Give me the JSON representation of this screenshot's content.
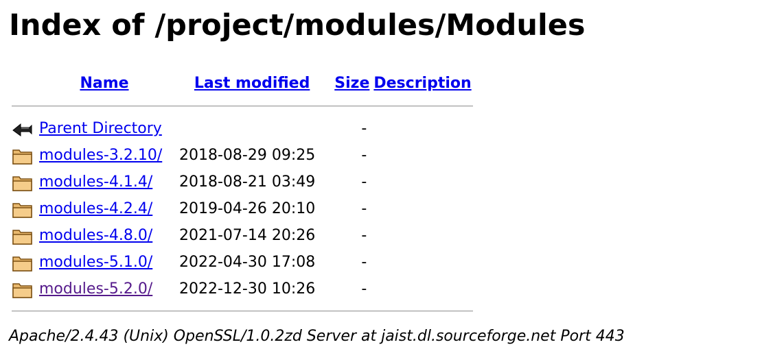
{
  "title": "Index of /project/modules/Modules",
  "columns": {
    "name": "Name",
    "last_modified": "Last modified",
    "size": "Size",
    "description": "Description"
  },
  "parent": {
    "label": "Parent Directory",
    "size": "-",
    "icon": "back-icon"
  },
  "rows": [
    {
      "name": "modules-3.2.10/",
      "date": "2018-08-29 09:25",
      "size": "-",
      "icon": "folder-icon"
    },
    {
      "name": "modules-4.1.4/",
      "date": "2018-08-21 03:49",
      "size": "-",
      "icon": "folder-icon"
    },
    {
      "name": "modules-4.2.4/",
      "date": "2019-04-26 20:10",
      "size": "-",
      "icon": "folder-icon"
    },
    {
      "name": "modules-4.8.0/",
      "date": "2021-07-14 20:26",
      "size": "-",
      "icon": "folder-icon"
    },
    {
      "name": "modules-5.1.0/",
      "date": "2022-04-30 17:08",
      "size": "-",
      "icon": "folder-icon"
    },
    {
      "name": "modules-5.2.0/",
      "date": "2022-12-30 10:26",
      "size": "-",
      "icon": "folder-icon",
      "visited": true
    }
  ],
  "footer": "Apache/2.4.43 (Unix) OpenSSL/1.0.2zd Server at jaist.dl.sourceforge.net Port 443",
  "colors": {
    "link": "#0000ee",
    "visited_link": "#551a8b",
    "rule": "#9e9e9e"
  }
}
